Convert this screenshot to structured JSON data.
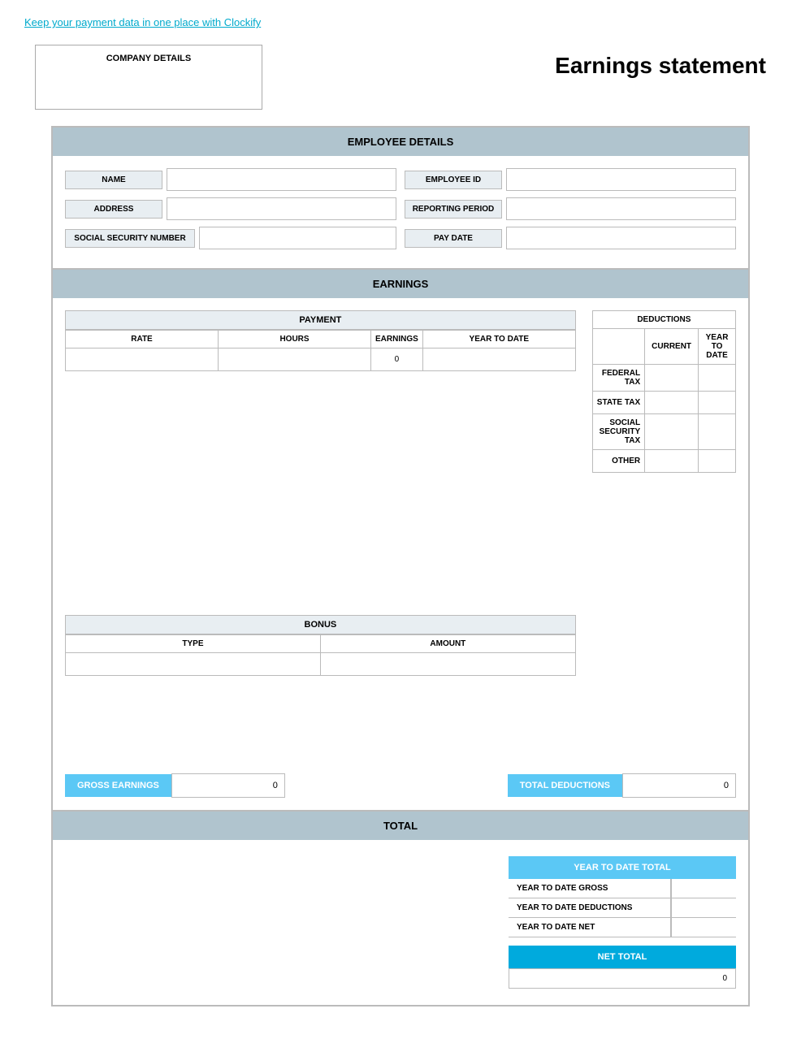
{
  "topLink": {
    "text": "Keep your payment data in one place with Clockify",
    "href": "#"
  },
  "header": {
    "companyLabel": "COMPANY DETAILS",
    "pageTitle": "Earnings statement"
  },
  "employeeDetails": {
    "sectionTitle": "EMPLOYEE DETAILS",
    "fields": {
      "name": {
        "label": "NAME",
        "value": ""
      },
      "address": {
        "label": "ADDRESS",
        "value": ""
      },
      "ssn": {
        "label": "SOCIAL SECURITY NUMBER",
        "value": ""
      },
      "employeeId": {
        "label": "EMPLOYEE ID",
        "value": ""
      },
      "reportingPeriod": {
        "label": "REPORTING PERIOD",
        "value": ""
      },
      "payDate": {
        "label": "PAY DATE",
        "value": ""
      }
    }
  },
  "earnings": {
    "sectionTitle": "EARNINGS",
    "payment": {
      "header": "PAYMENT",
      "columns": [
        "RATE",
        "HOURS",
        "EARNINGS",
        "YEAR TO DATE"
      ],
      "row": {
        "rate": "",
        "hours": "",
        "earnings": "0",
        "ytd": ""
      }
    },
    "deductions": {
      "header": "DEDUCTIONS",
      "columns": [
        "CURRENT",
        "YEAR TO DATE"
      ],
      "rows": [
        {
          "label": "FEDERAL TAX",
          "current": "",
          "ytd": ""
        },
        {
          "label": "STATE TAX",
          "current": "",
          "ytd": ""
        },
        {
          "label": "SOCIAL SECURITY TAX",
          "current": "",
          "ytd": ""
        },
        {
          "label": "OTHER",
          "current": "",
          "ytd": ""
        }
      ]
    },
    "bonus": {
      "header": "BONUS",
      "columns": [
        "TYPE",
        "AMOUNT"
      ],
      "row": {
        "type": "",
        "amount": ""
      }
    },
    "grossEarnings": {
      "label": "GROSS EARNINGS",
      "value": "0"
    },
    "totalDeductions": {
      "label": "TOTAL DEDUCTIONS",
      "value": "0"
    }
  },
  "total": {
    "sectionTitle": "TOTAL",
    "ytdTotal": {
      "header": "YEAR TO DATE TOTAL",
      "rows": [
        {
          "label": "YEAR TO DATE GROSS",
          "value": ""
        },
        {
          "label": "YEAR TO DATE DEDUCTIONS",
          "value": ""
        },
        {
          "label": "YEAR TO DATE NET",
          "value": ""
        }
      ]
    },
    "netTotal": {
      "label": "NET TOTAL",
      "value": "0"
    }
  }
}
